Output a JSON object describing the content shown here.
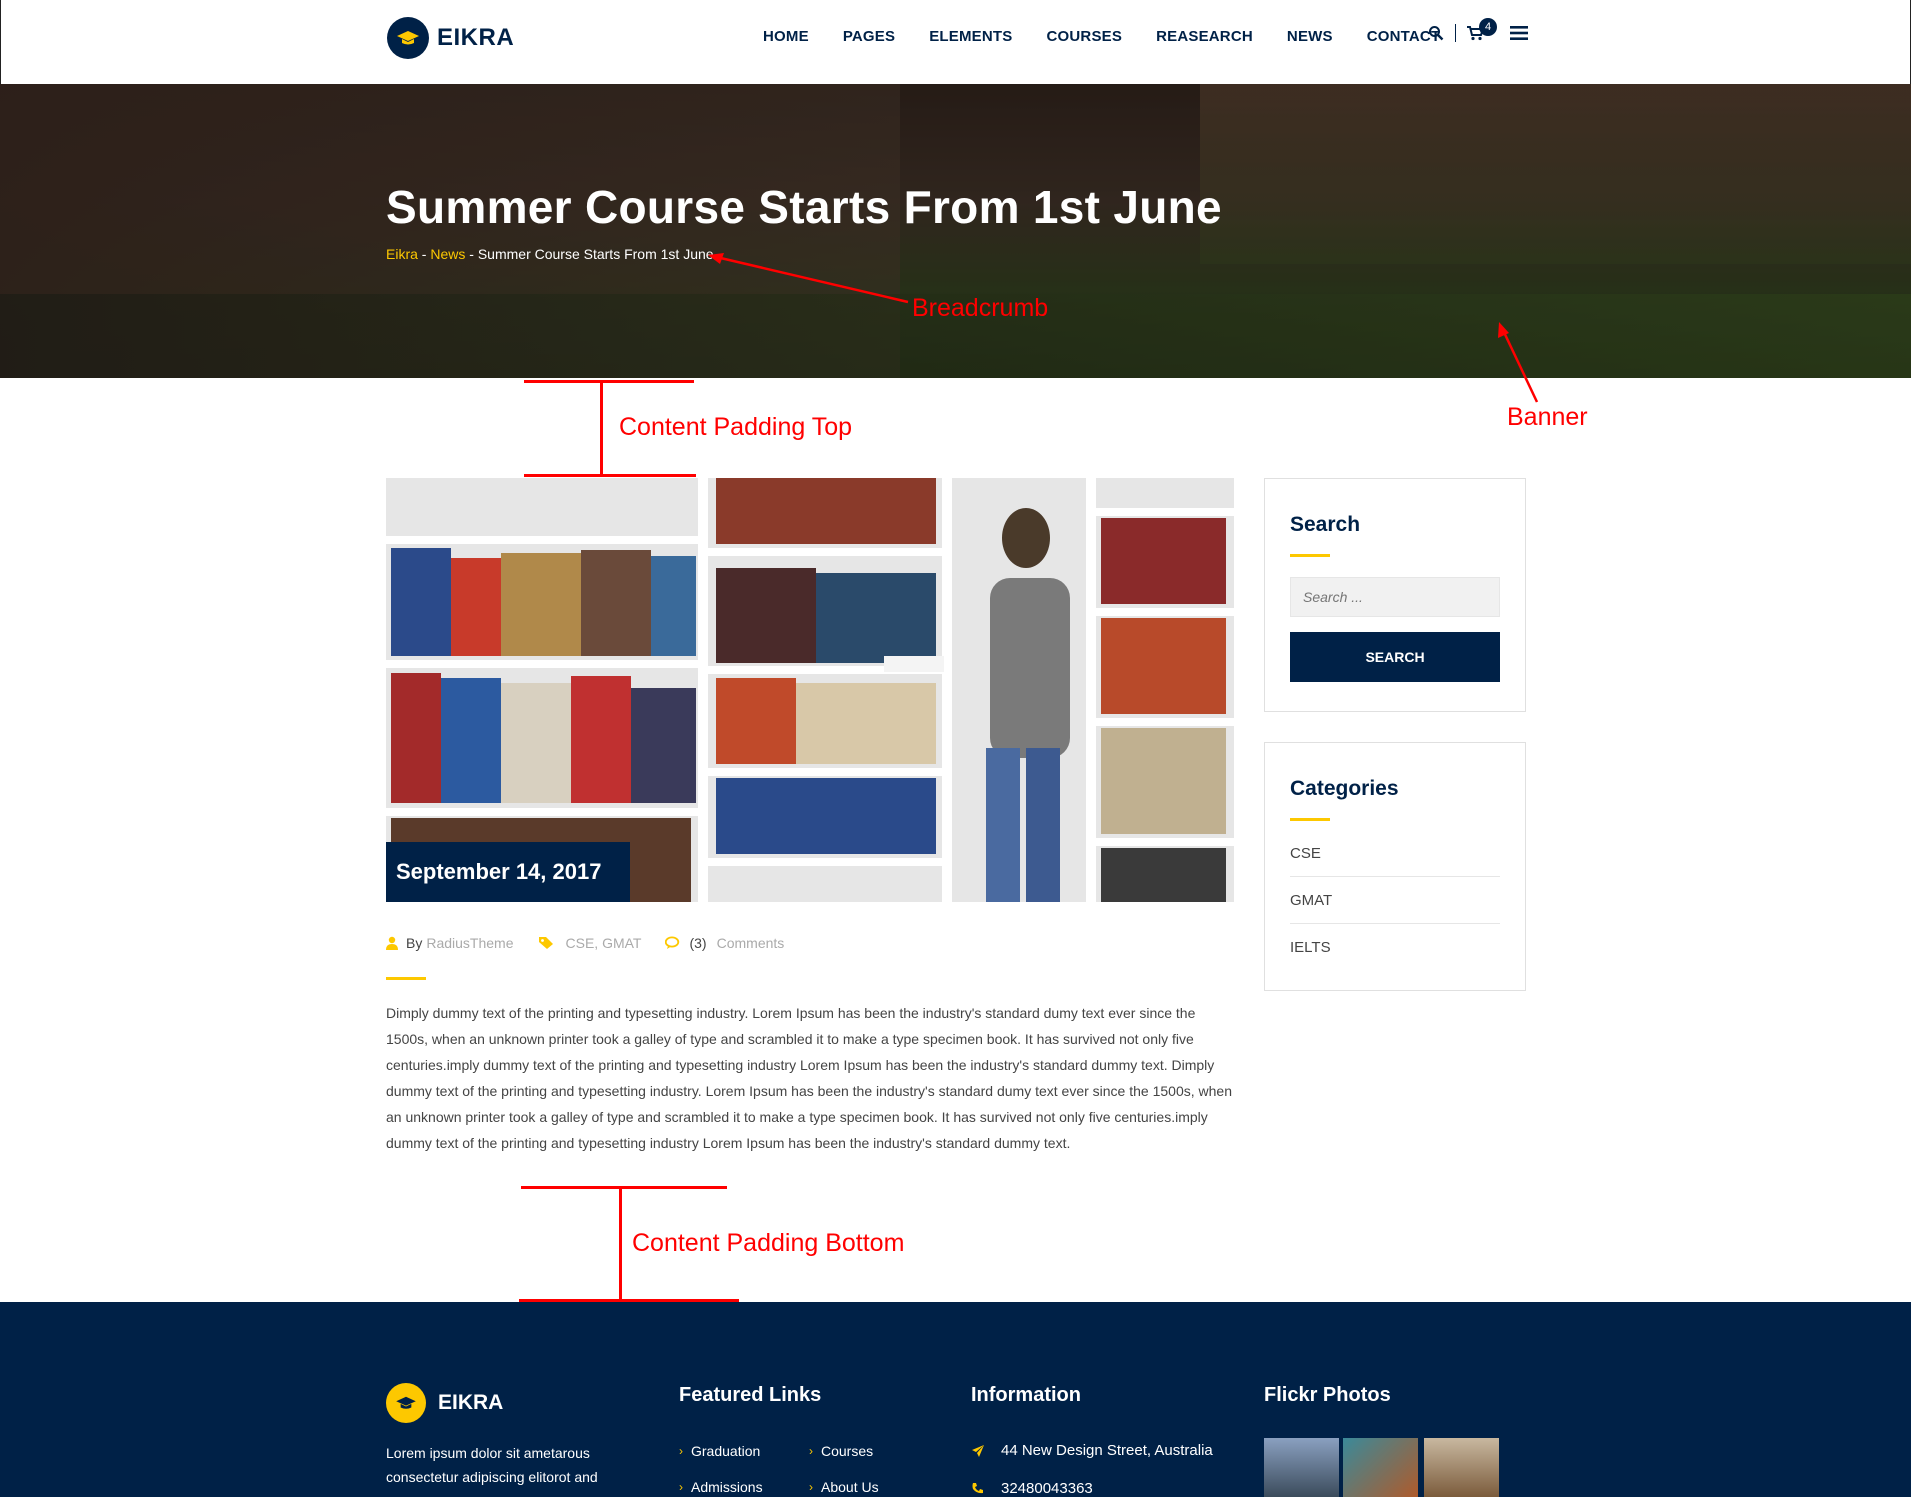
{
  "header": {
    "logo_text": "EIKRA",
    "nav": [
      "HOME",
      "PAGES",
      "ELEMENTS",
      "COURSES",
      "REASEARCH",
      "NEWS",
      "CONTACT"
    ],
    "cart_count": "4",
    "icons": [
      "search-icon",
      "cart-icon",
      "menu-icon"
    ]
  },
  "banner": {
    "title": "Summer Course Starts From 1st June",
    "breadcrumb": {
      "home": "Eikra",
      "sep1": " - ",
      "section": "News",
      "sep2": " - ",
      "current": "Summer Course Starts From 1st June"
    }
  },
  "annotations": {
    "breadcrumb": "Breadcrumb",
    "banner": "Banner",
    "padding_top": "Content Padding Top",
    "padding_bottom": "Content Padding Bottom"
  },
  "post": {
    "date": "September 14, 2017",
    "meta": {
      "by_label": "By",
      "author": "RadiusTheme",
      "categories": "CSE, GMAT",
      "comment_count": "(3)",
      "comments_label": "Comments"
    },
    "body": "Dimply dummy text of the printing and typesetting industry. Lorem Ipsum has been the industry's standard dumy text ever since the 1500s, when an unknown printer took a galley of type and scrambled it to make a type specimen book. It has survived not only five centuries.imply dummy text of the printing and typesetting industry Lorem Ipsum has been the industry's standard dummy text. Dimply dummy text of the printing and typesetting industry. Lorem Ipsum has been the industry's standard dumy text ever since the 1500s, when an unknown printer took a galley of type and scrambled it to make a type specimen book. It has survived not only five centuries.imply dummy text of the printing and typesetting industry Lorem Ipsum has been the industry's standard dummy text."
  },
  "sidebar": {
    "search": {
      "title": "Search",
      "placeholder": "Search ...",
      "button": "SEARCH"
    },
    "categories": {
      "title": "Categories",
      "items": [
        "CSE",
        "GMAT",
        "IELTS"
      ]
    }
  },
  "footer": {
    "logo_text": "EIKRA",
    "about": "Lorem ipsum dolor sit ametarous consectetur adipiscing elitorot and",
    "featured_title": "Featured Links",
    "featured_links": [
      "Graduation",
      "Courses",
      "Admissions",
      "About Us"
    ],
    "info_title": "Information",
    "address": "44 New Design Street, Australia",
    "phone": "32480043363",
    "flickr_title": "Flickr Photos"
  },
  "colors": {
    "navy": "#002147",
    "accent": "#fdc800",
    "annotation": "#ff0000"
  }
}
